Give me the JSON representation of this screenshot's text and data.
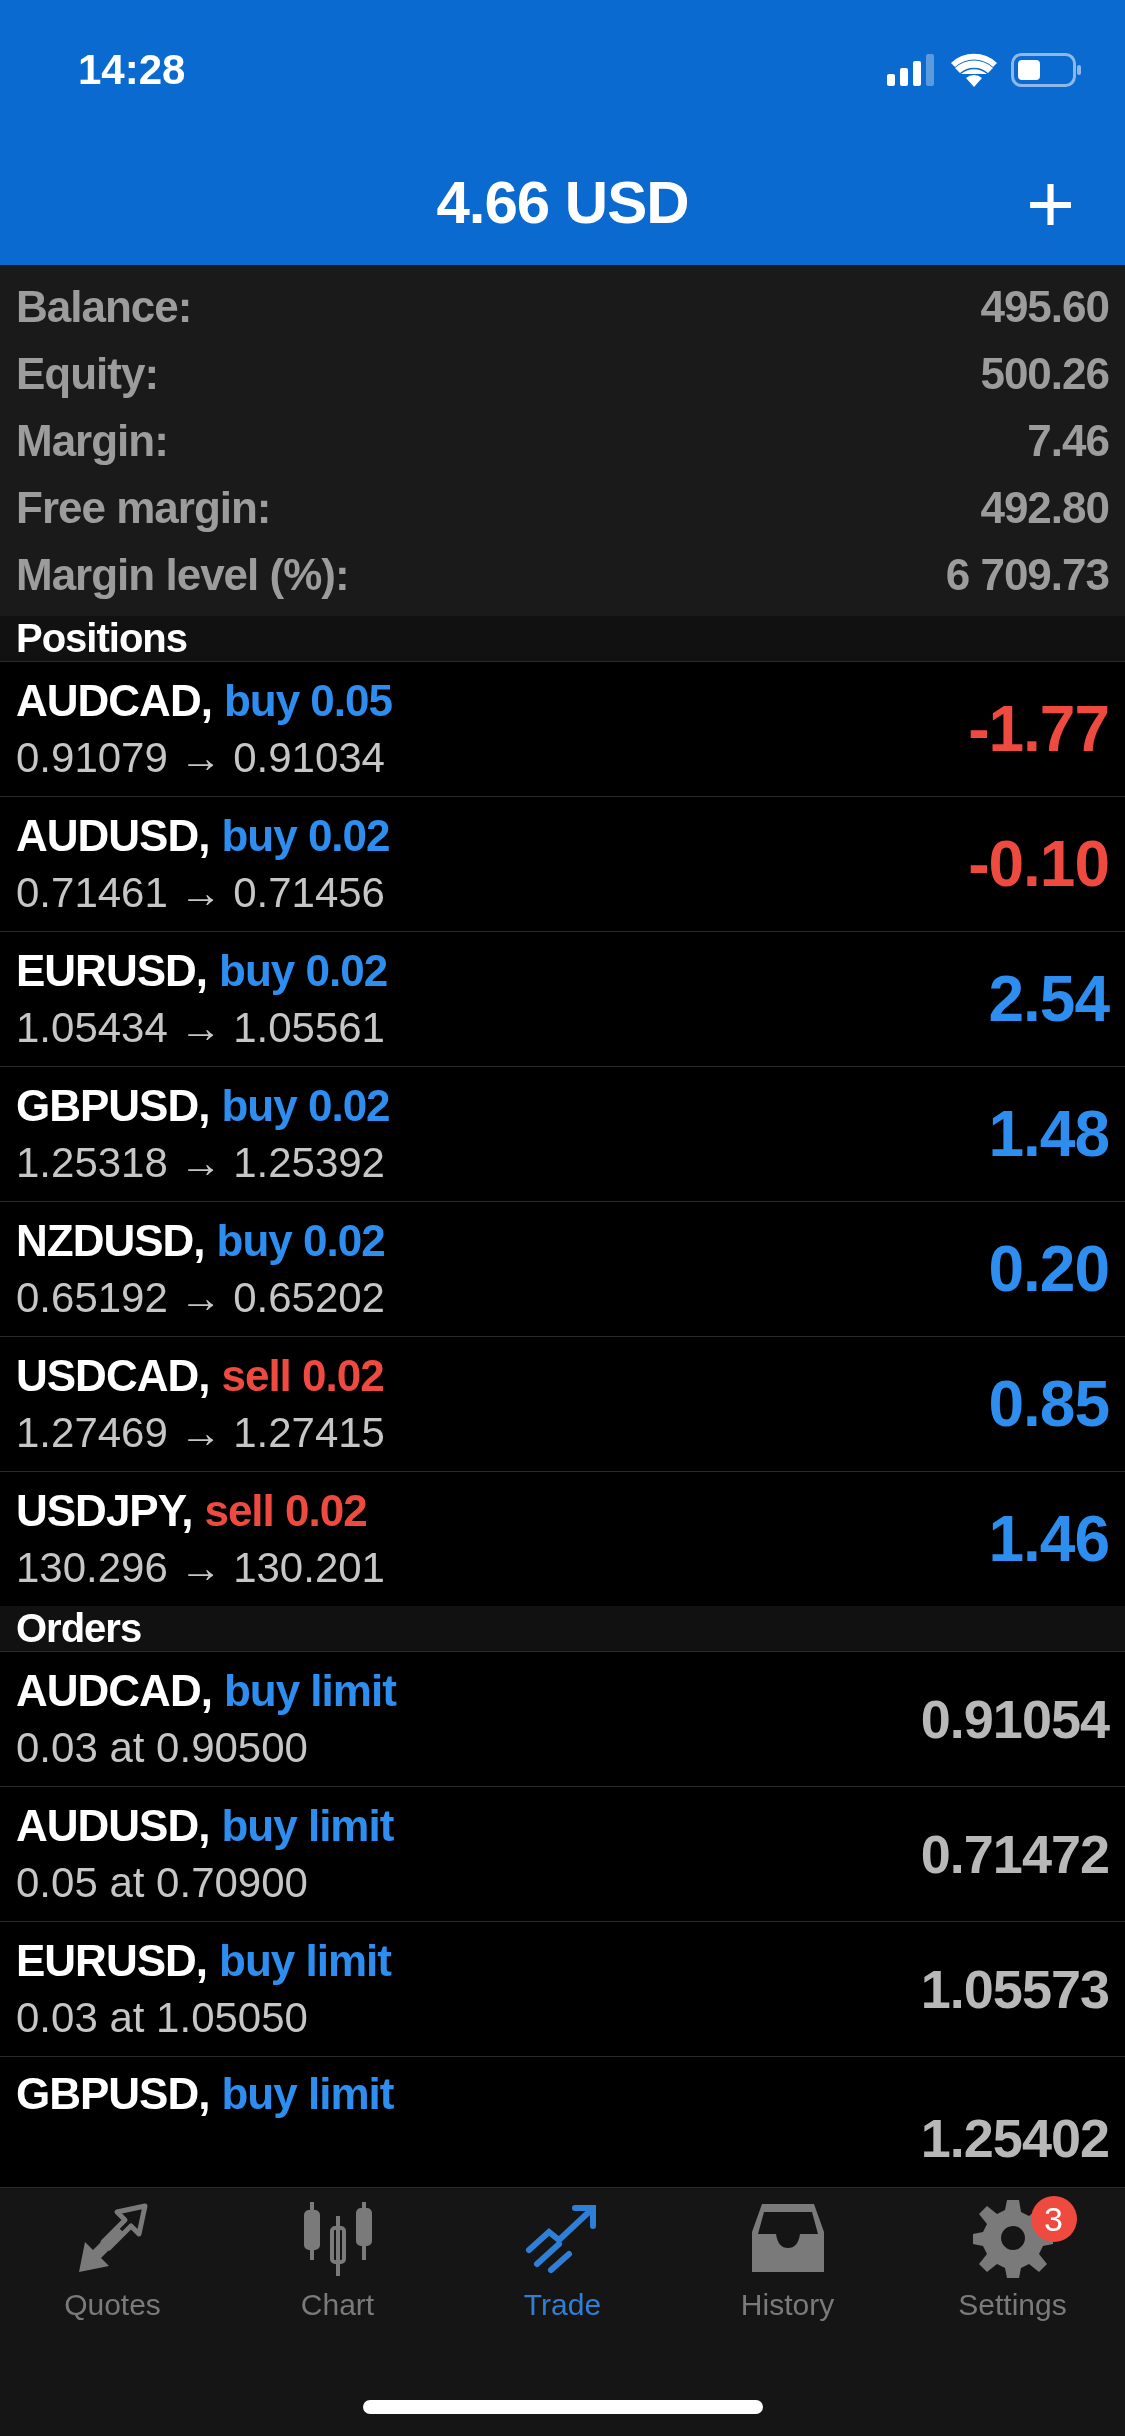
{
  "status_bar": {
    "time": "14:28"
  },
  "header": {
    "title": "4.66 USD",
    "add_button": "+"
  },
  "summary": [
    {
      "label": "Balance:",
      "value": "495.60"
    },
    {
      "label": "Equity:",
      "value": "500.26"
    },
    {
      "label": "Margin:",
      "value": "7.46"
    },
    {
      "label": "Free margin:",
      "value": "492.80"
    },
    {
      "label": "Margin level (%):",
      "value": "6 709.73"
    }
  ],
  "positions": {
    "title": "Positions",
    "items": [
      {
        "symbol": "AUDCAD,",
        "kind": "buy",
        "action": "buy 0.05",
        "prices": "0.91079 → 0.91034",
        "profit": "-1.77",
        "loss": true
      },
      {
        "symbol": "AUDUSD,",
        "kind": "buy",
        "action": "buy 0.02",
        "prices": "0.71461 → 0.71456",
        "profit": "-0.10",
        "loss": true
      },
      {
        "symbol": "EURUSD,",
        "kind": "buy",
        "action": "buy 0.02",
        "prices": "1.05434 → 1.05561",
        "profit": "2.54",
        "loss": false
      },
      {
        "symbol": "GBPUSD,",
        "kind": "buy",
        "action": "buy 0.02",
        "prices": "1.25318 → 1.25392",
        "profit": "1.48",
        "loss": false
      },
      {
        "symbol": "NZDUSD,",
        "kind": "buy",
        "action": "buy 0.02",
        "prices": "0.65192 → 0.65202",
        "profit": "0.20",
        "loss": false
      },
      {
        "symbol": "USDCAD,",
        "kind": "sell",
        "action": "sell 0.02",
        "prices": "1.27469 → 1.27415",
        "profit": "0.85",
        "loss": false
      },
      {
        "symbol": "USDJPY,",
        "kind": "sell",
        "action": "sell 0.02",
        "prices": "130.296 → 130.201",
        "profit": "1.46",
        "loss": false
      }
    ]
  },
  "orders": {
    "title": "Orders",
    "items": [
      {
        "symbol": "AUDCAD,",
        "kind": "buy",
        "action": "buy limit",
        "detail": "0.03 at 0.90500",
        "price": "0.91054"
      },
      {
        "symbol": "AUDUSD,",
        "kind": "buy",
        "action": "buy limit",
        "detail": "0.05 at 0.70900",
        "price": "0.71472"
      },
      {
        "symbol": "EURUSD,",
        "kind": "buy",
        "action": "buy limit",
        "detail": "0.03 at 1.05050",
        "price": "1.05573"
      },
      {
        "symbol": "GBPUSD,",
        "kind": "buy",
        "action": "buy limit",
        "price": "1.25402"
      }
    ]
  },
  "tab_bar": [
    {
      "label": "Quotes",
      "kind": "quotes",
      "selected": false
    },
    {
      "label": "Chart",
      "kind": "chart",
      "selected": false
    },
    {
      "label": "Trade",
      "kind": "trade",
      "selected": true
    },
    {
      "label": "History",
      "kind": "history",
      "selected": false
    },
    {
      "label": "Settings",
      "kind": "settings",
      "selected": false,
      "badge": "3"
    }
  ]
}
